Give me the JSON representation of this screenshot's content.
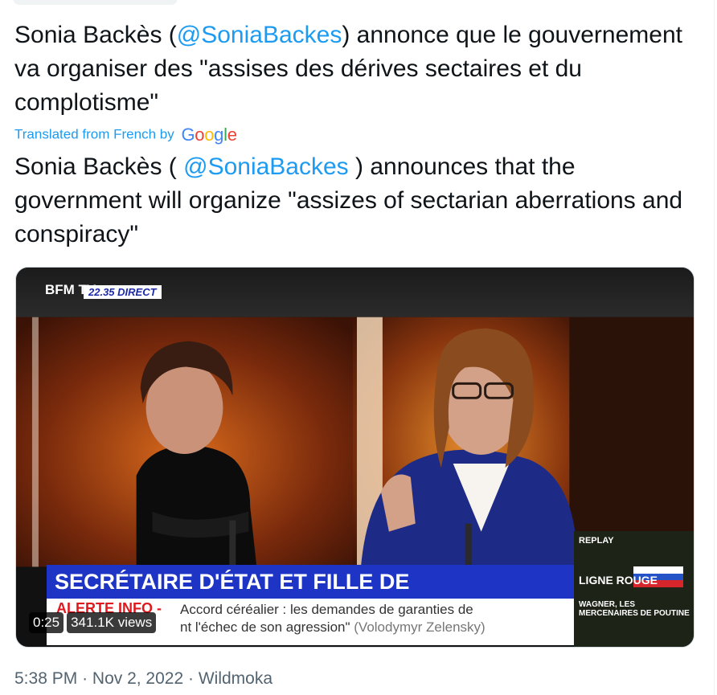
{
  "tweet": {
    "original_before": "Sonia Backès (",
    "original_mention": "@SoniaBackes",
    "original_after": ") annonce que le gouvernement va organiser des \"assises des dérives sectaires et du complotisme\"",
    "translated_label": "Translated from French by",
    "translator_brand": "Google",
    "translation_before": "Sonia Backès ( ",
    "translation_mention": "@SoniaBackes",
    "translation_after": " ) announces that the government will organize \"assizes of sectarian aberrations and conspiracy\""
  },
  "video": {
    "channel_logo": "BFM TV.",
    "live_label": "22.35 DIRECT",
    "banner_text": "SECRÉTAIRE D'ÉTAT ET FILLE DE SCIENTOLOGUE",
    "alert_label": "ALERTE INFO -",
    "ticker_line1": "Accord céréalier : les demandes de garanties de",
    "ticker_line2_a": "nt l'échec de son agression\"",
    "ticker_line2_b": "(Volodymyr Zelensky)",
    "replay_label": "REPLAY",
    "replay_title": "LIGNE ROUGE",
    "replay_subtitle": "WAGNER, LES MERCENAIRES DE POUTINE",
    "duration": "0:25",
    "views": "341.1K views"
  },
  "meta": {
    "time": "5:38 PM",
    "date": "Nov 2, 2022",
    "source": "Wildmoka",
    "separator": "·"
  },
  "colors": {
    "accent": "#1d9bf0",
    "text": "#0f1419",
    "secondary": "#536471",
    "banner_blue": "#1d34c4",
    "alert_red": "#e0191f"
  }
}
